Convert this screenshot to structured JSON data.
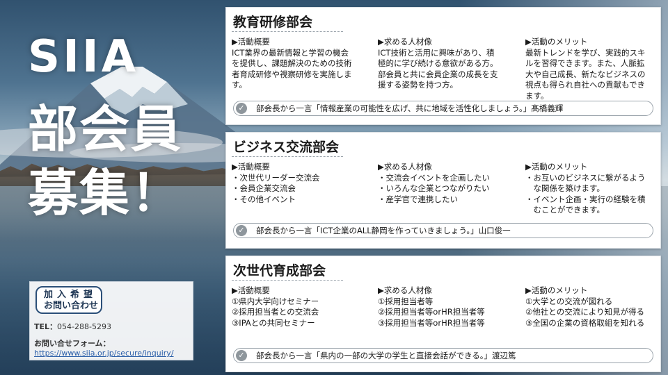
{
  "hero": {
    "line1": "SIIA",
    "line2": "部会員",
    "line3": "募集！"
  },
  "contact": {
    "badge_line1": "加入希望",
    "badge_line2": "お問い合わせ",
    "tel_label": "TEL：",
    "tel_value": "054-288-5293",
    "form_label": "お問い合せフォーム：",
    "form_url": "https://www.siia.or.jp/secure/inquiry/"
  },
  "panels": [
    {
      "title": "教育研修部会",
      "columns": [
        {
          "heading": "▶活動概要",
          "lines": [
            "ICT業界の最新情報と学習の機会",
            "を提供し、課題解決のための技術",
            "者育成研修や視察研修を実施しま",
            "す。"
          ]
        },
        {
          "heading": "▶求める人材像",
          "lines": [
            "ICT技術と活用に興味があり、積",
            "極的に学び続ける意欲がある方。",
            "部会員と共に会員企業の成長を支",
            "援する姿勢を持つ方。"
          ]
        },
        {
          "heading": "▶活動のメリット",
          "lines": [
            "最新トレンドを学び、実践的スキ",
            "ルを習得できます。また、人脈拡",
            "大や自己成長、新たなビジネスの",
            "視点も得られ自社への貢献もでき",
            "ます。"
          ]
        }
      ],
      "comment": "部会長から一言「情報産業の可能性を広げ、共に地域を活性化しましょう。」髙橋義輝"
    },
    {
      "title": "ビジネス交流部会",
      "columns": [
        {
          "heading": "▶活動概要",
          "lines": [
            "・次世代リーダー交流会",
            "・会員企業交流会",
            "・その他イベント"
          ]
        },
        {
          "heading": "▶求める人材像",
          "lines": [
            "・交流会イベントを企画したい",
            "・いろんな企業とつながりたい",
            "・産学官で連携したい"
          ]
        },
        {
          "heading": "▶活動のメリット",
          "lines": [
            "・お互いのビジネスに繋がるよう",
            "　な関係を築けます。",
            "・イベント企画・実行の経験を積",
            "　むことができます。"
          ]
        }
      ],
      "comment": "部会長から一言「ICT企業のALL静岡を作っていきましょう。」山口俊一"
    },
    {
      "title": "次世代育成部会",
      "columns": [
        {
          "heading": "▶活動概要",
          "lines": [
            "①県内大学向けセミナー",
            "②採用担当者との交流会",
            "③IPAとの共同セミナー"
          ]
        },
        {
          "heading": "▶求める人材像",
          "lines": [
            "①採用担当者等",
            "②採用担当者等orHR担当者等",
            "③採用担当者等orHR担当者等"
          ]
        },
        {
          "heading": "▶活動のメリット",
          "lines": [
            "①大学との交流が図れる",
            "②他社との交流により知見が得る",
            "③全国の企業の資格取組を知れる"
          ]
        }
      ],
      "comment": "部会長から一言「県内の一部の大学の学生と直接会話ができる。」渡辺篤"
    }
  ]
}
